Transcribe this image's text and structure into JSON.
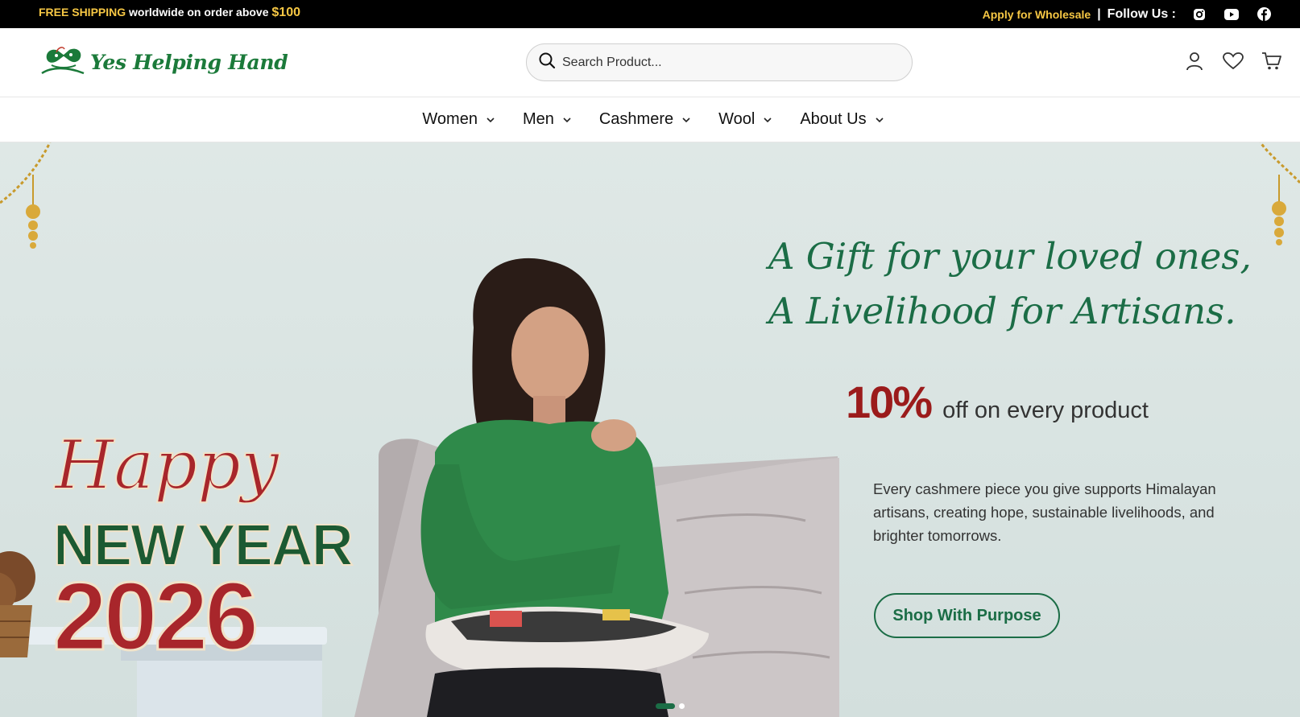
{
  "topbar": {
    "free_shipping": "FREE SHIPPING",
    "promo_text": "worldwide on order above",
    "promo_amount": "$100",
    "wholesale_link": "Apply for Wholesale",
    "separator": "|",
    "follow_label": "Follow Us :",
    "social_icons": [
      "instagram-icon",
      "youtube-icon",
      "facebook-icon"
    ]
  },
  "header": {
    "logo_text": "Yes Helping Hand",
    "search_placeholder": "Search Product...",
    "icons": [
      "user-icon",
      "heart-icon",
      "cart-icon"
    ]
  },
  "nav": {
    "items": [
      {
        "label": "Women"
      },
      {
        "label": "Men"
      },
      {
        "label": "Cashmere"
      },
      {
        "label": "Wool"
      },
      {
        "label": "About Us"
      }
    ]
  },
  "hero": {
    "headline_line1": "A Gift for your loved ones,",
    "headline_line2": "A Livelihood for Artisans.",
    "discount_percent": "10%",
    "discount_text": "off on every product",
    "description": "Every cashmere piece you give supports Himalayan artisans, creating hope, sustainable livelihoods, and brighter tomorrows.",
    "cta_label": "Shop With Purpose",
    "banner_greeting_line1": "Happy",
    "banner_greeting_line2": "NEW YEAR",
    "banner_year": "2026",
    "slide_count": 2,
    "active_slide": 1
  },
  "colors": {
    "brand_green": "#1b6d46",
    "accent_yellow": "#f6c744",
    "discount_red": "#9b1b1b",
    "topbar_bg": "#000000"
  }
}
